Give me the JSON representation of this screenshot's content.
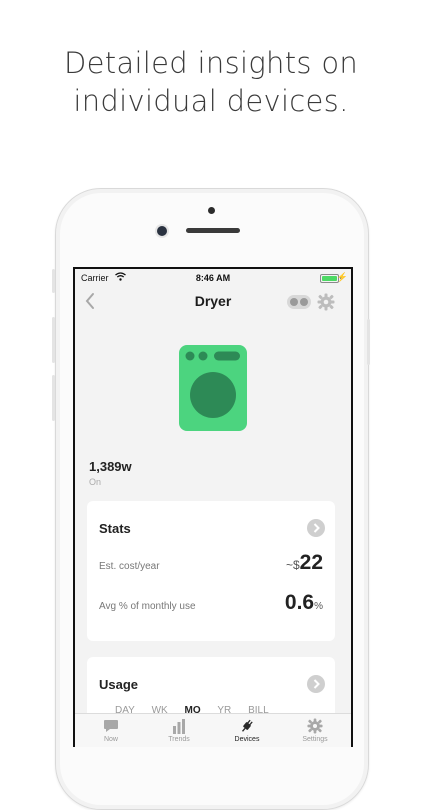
{
  "headline": {
    "line1": "Detailed insights on",
    "line2": "individual devices."
  },
  "status_bar": {
    "carrier": "Carrier",
    "time": "8:46 AM"
  },
  "nav": {
    "title": "Dryer"
  },
  "device": {
    "icon": "dryer-icon",
    "accent_color": "#4cd47f",
    "dark_color": "#2d8a56",
    "power": "1,389w",
    "status": "On"
  },
  "stats": {
    "title": "Stats",
    "cost_label": "Est. cost/year",
    "cost_prefix": "~$",
    "cost_value": "22",
    "avg_label": "Avg % of monthly use",
    "avg_value": "0.6",
    "avg_unit": "%"
  },
  "usage": {
    "title": "Usage",
    "periods": [
      "DAY",
      "WK",
      "MO",
      "YR",
      "BILL"
    ],
    "active_period": "MO"
  },
  "tabs": [
    {
      "label": "Now",
      "icon": "chat-bubble-icon"
    },
    {
      "label": "Trends",
      "icon": "bar-chart-icon"
    },
    {
      "label": "Devices",
      "icon": "plug-icon"
    },
    {
      "label": "Settings",
      "icon": "gear-icon"
    }
  ],
  "active_tab": "Devices"
}
